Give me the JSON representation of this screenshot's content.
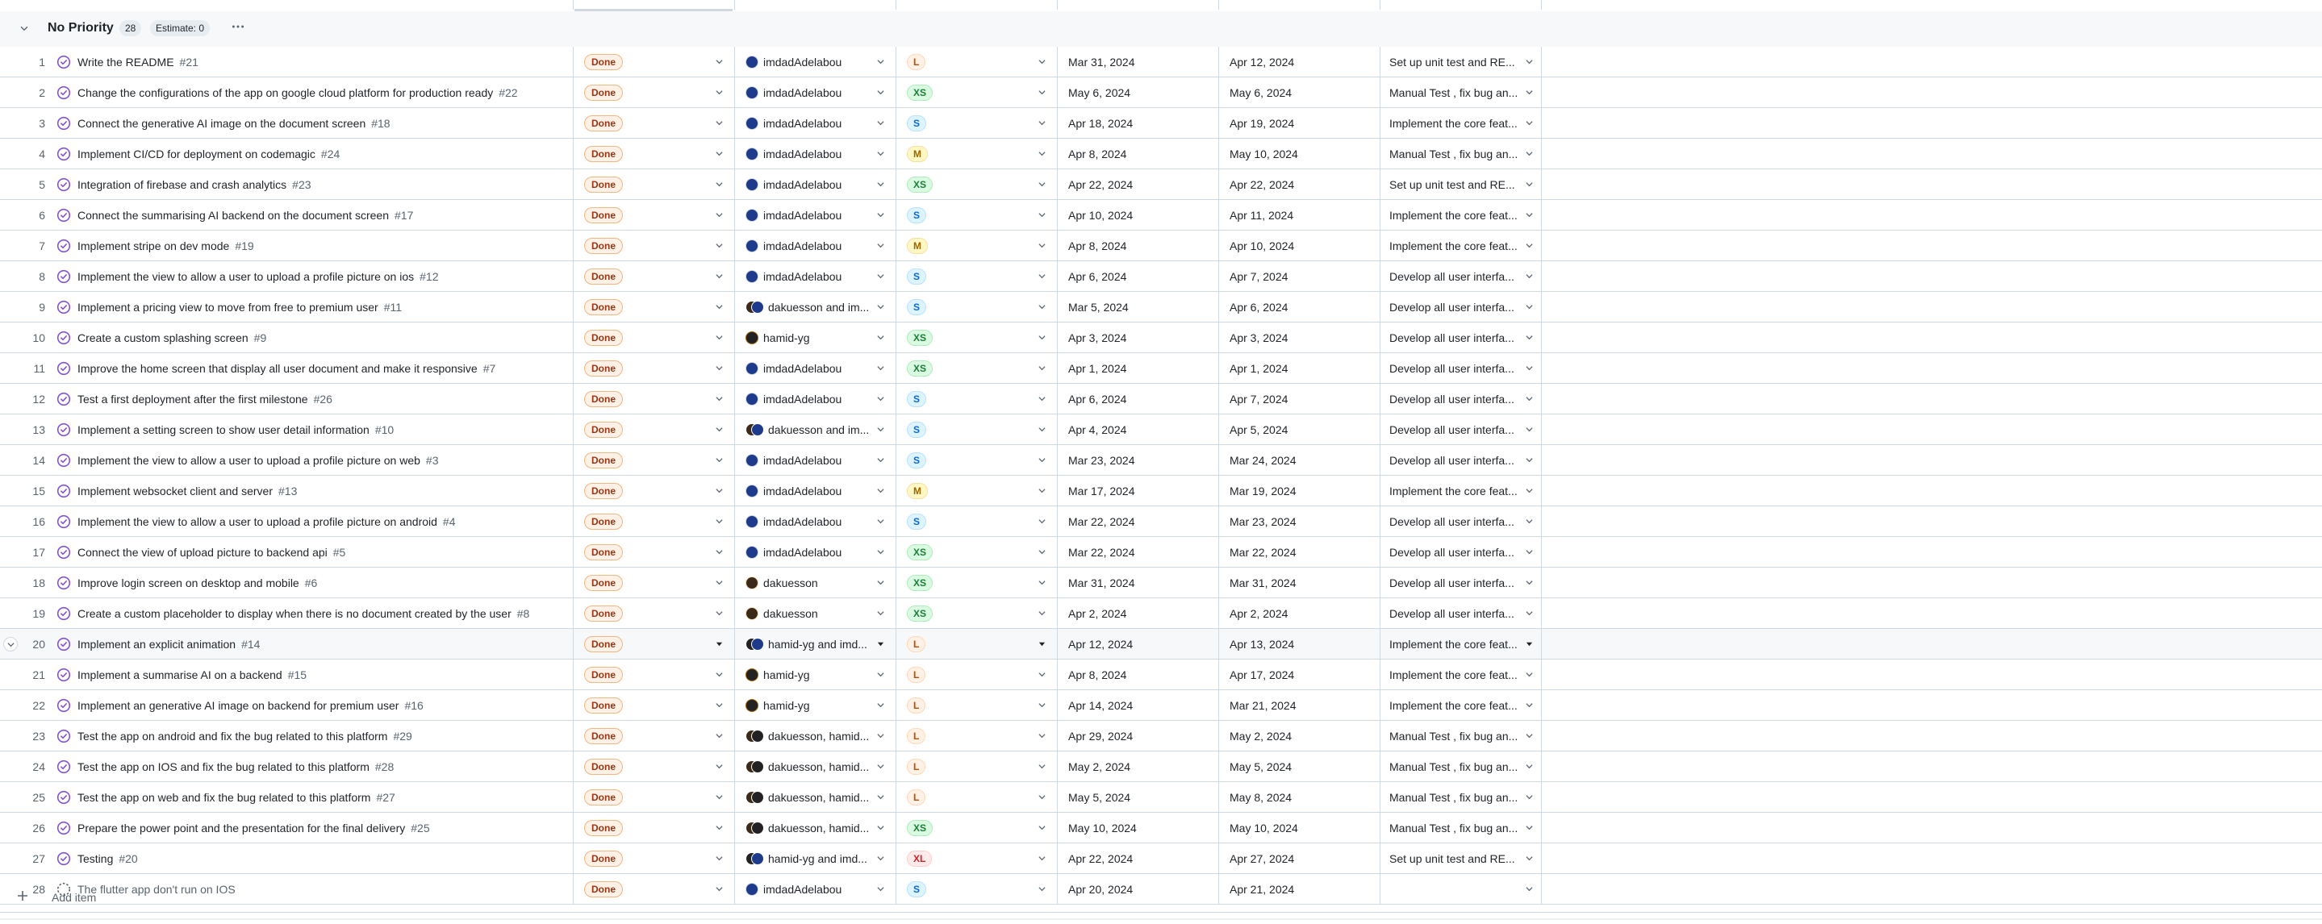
{
  "group": {
    "chevron_icon": "chevron-down-icon",
    "title": "No Priority",
    "count": "28",
    "estimate": "Estimate: 0",
    "more_icon": "kebab-horizontal-icon"
  },
  "add_item": {
    "plus_icon": "plus-icon",
    "label": "Add item"
  },
  "colors": {
    "done_text": "#9a3412",
    "done_bg": "#fff1e5",
    "issue_closed": "#8250df",
    "size_L": "#bc4c00",
    "size_XS": "#1a7f37",
    "size_S": "#0969da",
    "size_M": "#9a6700",
    "size_XL": "#cf222e"
  },
  "rows": [
    {
      "index": "1",
      "title": "Write the README",
      "number": "#21",
      "status": "Done",
      "assignee": "imdadAdelabou",
      "avatars": "i",
      "size": "L",
      "start": "Mar 31, 2024",
      "end": "Apr 12, 2024",
      "milestone": "Set up unit test and RE..."
    },
    {
      "index": "2",
      "title": "Change the configurations of the app on google cloud platform for production ready",
      "number": "#22",
      "status": "Done",
      "assignee": "imdadAdelabou",
      "avatars": "i",
      "size": "XS",
      "start": "May 6, 2024",
      "end": "May 6, 2024",
      "milestone": "Manual Test , fix bug an..."
    },
    {
      "index": "3",
      "title": "Connect the generative AI image on the document screen",
      "number": "#18",
      "status": "Done",
      "assignee": "imdadAdelabou",
      "avatars": "i",
      "size": "S",
      "start": "Apr 18, 2024",
      "end": "Apr 19, 2024",
      "milestone": "Implement the core feat..."
    },
    {
      "index": "4",
      "title": "Implement CI/CD for deployment on codemagic",
      "number": "#24",
      "status": "Done",
      "assignee": "imdadAdelabou",
      "avatars": "i",
      "size": "M",
      "start": "Apr 8, 2024",
      "end": "May 10, 2024",
      "milestone": "Manual Test , fix bug an..."
    },
    {
      "index": "5",
      "title": "Integration of firebase and crash analytics",
      "number": "#23",
      "status": "Done",
      "assignee": "imdadAdelabou",
      "avatars": "i",
      "size": "XS",
      "start": "Apr 22, 2024",
      "end": "Apr 22, 2024",
      "milestone": "Set up unit test and RE..."
    },
    {
      "index": "6",
      "title": "Connect the summarising AI backend on the document screen",
      "number": "#17",
      "status": "Done",
      "assignee": "imdadAdelabou",
      "avatars": "i",
      "size": "S",
      "start": "Apr 10, 2024",
      "end": "Apr 11, 2024",
      "milestone": "Implement the core feat..."
    },
    {
      "index": "7",
      "title": "Implement stripe on dev mode",
      "number": "#19",
      "status": "Done",
      "assignee": "imdadAdelabou",
      "avatars": "i",
      "size": "M",
      "start": "Apr 8, 2024",
      "end": "Apr 10, 2024",
      "milestone": "Implement the core feat..."
    },
    {
      "index": "8",
      "title": "Implement the view to allow a user to upload a profile picture on ios",
      "number": "#12",
      "status": "Done",
      "assignee": "imdadAdelabou",
      "avatars": "i",
      "size": "S",
      "start": "Apr 6, 2024",
      "end": "Apr 7, 2024",
      "milestone": "Develop all user interfa..."
    },
    {
      "index": "9",
      "title": "Implement a pricing view to move from free to premium user",
      "number": "#11",
      "status": "Done",
      "assignee": "dakuesson and im...",
      "avatars": "di",
      "size": "S",
      "start": "Mar 5, 2024",
      "end": "Apr 6, 2024",
      "milestone": "Develop all user interfa..."
    },
    {
      "index": "10",
      "title": "Create a custom splashing screen",
      "number": "#9",
      "status": "Done",
      "assignee": "hamid-yg",
      "avatars": "h",
      "size": "XS",
      "start": "Apr 3, 2024",
      "end": "Apr 3, 2024",
      "milestone": "Develop all user interfa..."
    },
    {
      "index": "11",
      "title": "Improve the home screen that display all user document and make it responsive",
      "number": "#7",
      "status": "Done",
      "assignee": "imdadAdelabou",
      "avatars": "i",
      "size": "XS",
      "start": "Apr 1, 2024",
      "end": "Apr 1, 2024",
      "milestone": "Develop all user interfa..."
    },
    {
      "index": "12",
      "title": "Test a first deployment after the first milestone",
      "number": "#26",
      "status": "Done",
      "assignee": "imdadAdelabou",
      "avatars": "i",
      "size": "S",
      "start": "Apr 6, 2024",
      "end": "Apr 7, 2024",
      "milestone": "Develop all user interfa..."
    },
    {
      "index": "13",
      "title": "Implement a setting screen to show user detail information",
      "number": "#10",
      "status": "Done",
      "assignee": "dakuesson and im...",
      "avatars": "di",
      "size": "S",
      "start": "Apr 4, 2024",
      "end": "Apr 5, 2024",
      "milestone": "Develop all user interfa..."
    },
    {
      "index": "14",
      "title": "Implement the view to allow a user to upload a profile picture on web",
      "number": "#3",
      "status": "Done",
      "assignee": "imdadAdelabou",
      "avatars": "i",
      "size": "S",
      "start": "Mar 23, 2024",
      "end": "Mar 24, 2024",
      "milestone": "Develop all user interfa..."
    },
    {
      "index": "15",
      "title": "Implement websocket client and server",
      "number": "#13",
      "status": "Done",
      "assignee": "imdadAdelabou",
      "avatars": "i",
      "size": "M",
      "start": "Mar 17, 2024",
      "end": "Mar 19, 2024",
      "milestone": "Implement the core feat..."
    },
    {
      "index": "16",
      "title": "Implement the view to allow a user to upload a profile picture on android",
      "number": "#4",
      "status": "Done",
      "assignee": "imdadAdelabou",
      "avatars": "i",
      "size": "S",
      "start": "Mar 22, 2024",
      "end": "Mar 23, 2024",
      "milestone": "Develop all user interfa..."
    },
    {
      "index": "17",
      "title": "Connect the view of upload picture to backend api",
      "number": "#5",
      "status": "Done",
      "assignee": "imdadAdelabou",
      "avatars": "i",
      "size": "XS",
      "start": "Mar 22, 2024",
      "end": "Mar 22, 2024",
      "milestone": "Develop all user interfa..."
    },
    {
      "index": "18",
      "title": "Improve login screen on desktop and mobile",
      "number": "#6",
      "status": "Done",
      "assignee": "dakuesson",
      "avatars": "d",
      "size": "XS",
      "start": "Mar 31, 2024",
      "end": "Mar 31, 2024",
      "milestone": "Develop all user interfa..."
    },
    {
      "index": "19",
      "title": "Create a custom placeholder to display when there is no document created by the user",
      "number": "#8",
      "status": "Done",
      "assignee": "dakuesson",
      "avatars": "d",
      "size": "XS",
      "start": "Apr 2, 2024",
      "end": "Apr 2, 2024",
      "milestone": "Develop all user interfa..."
    },
    {
      "index": "20",
      "title": "Implement an explicit animation",
      "number": "#14",
      "status": "Done",
      "assignee": "hamid-yg and imd...",
      "avatars": "hi",
      "size": "L",
      "start": "Apr 12, 2024",
      "end": "Apr 13, 2024",
      "milestone": "Implement the core feat...",
      "hover": true
    },
    {
      "index": "21",
      "title": "Implement a summarise AI on a backend",
      "number": "#15",
      "status": "Done",
      "assignee": "hamid-yg",
      "avatars": "h",
      "size": "L",
      "start": "Apr 8, 2024",
      "end": "Apr 17, 2024",
      "milestone": "Implement the core feat..."
    },
    {
      "index": "22",
      "title": "Implement an generative AI image on backend for premium user",
      "number": "#16",
      "status": "Done",
      "assignee": "hamid-yg",
      "avatars": "h",
      "size": "L",
      "start": "Apr 14, 2024",
      "end": "Mar 21, 2024",
      "milestone": "Implement the core feat..."
    },
    {
      "index": "23",
      "title": "Test the app on android and fix the bug related to this platform",
      "number": "#29",
      "status": "Done",
      "assignee": "dakuesson, hamid...",
      "avatars": "dh",
      "size": "L",
      "start": "Apr 29, 2024",
      "end": "May 2, 2024",
      "milestone": "Manual Test , fix bug an..."
    },
    {
      "index": "24",
      "title": "Test the app on IOS and fix the bug related to this platform",
      "number": "#28",
      "status": "Done",
      "assignee": "dakuesson, hamid...",
      "avatars": "dh",
      "size": "L",
      "start": "May 2, 2024",
      "end": "May 5, 2024",
      "milestone": "Manual Test , fix bug an..."
    },
    {
      "index": "25",
      "title": "Test the app on web and fix the bug related to this platform",
      "number": "#27",
      "status": "Done",
      "assignee": "dakuesson, hamid...",
      "avatars": "dh",
      "size": "L",
      "start": "May 5, 2024",
      "end": "May 8, 2024",
      "milestone": "Manual Test , fix bug an..."
    },
    {
      "index": "26",
      "title": "Prepare the power point and the presentation for the final delivery",
      "number": "#25",
      "status": "Done",
      "assignee": "dakuesson, hamid...",
      "avatars": "dh",
      "size": "XS",
      "start": "May 10, 2024",
      "end": "May 10, 2024",
      "milestone": "Manual Test , fix bug an..."
    },
    {
      "index": "27",
      "title": "Testing",
      "number": "#20",
      "status": "Done",
      "assignee": "hamid-yg and imd...",
      "avatars": "hi",
      "size": "XL",
      "start": "Apr 22, 2024",
      "end": "Apr 27, 2024",
      "milestone": "Set up unit test and RE..."
    },
    {
      "index": "28",
      "title": "The flutter app don't run on IOS",
      "number": "",
      "status": "Done",
      "assignee": "imdadAdelabou",
      "avatars": "i",
      "size": "S",
      "start": "Apr 20, 2024",
      "end": "Apr 21, 2024",
      "milestone": "",
      "draft": true
    }
  ]
}
